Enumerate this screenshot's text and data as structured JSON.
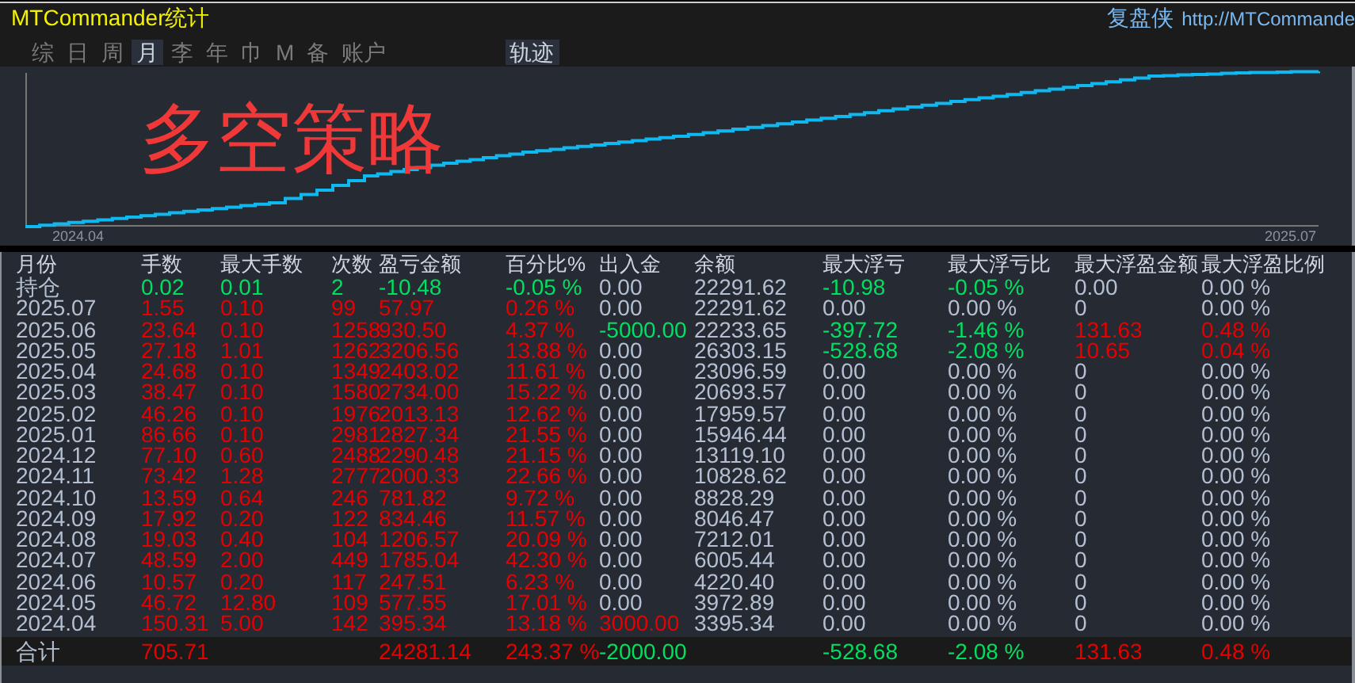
{
  "window": {
    "title": "MTCommander统计"
  },
  "header_right": {
    "brand": "复盘侠",
    "url": "http://MTCommande"
  },
  "tabs": [
    {
      "label": "综",
      "selected": false
    },
    {
      "label": "日",
      "selected": false
    },
    {
      "label": "周",
      "selected": false
    },
    {
      "label": "月",
      "selected": true
    },
    {
      "label": "李",
      "selected": false
    },
    {
      "label": "年",
      "selected": false
    },
    {
      "label": "巾",
      "selected": false
    },
    {
      "label": "M",
      "selected": false
    },
    {
      "label": "备",
      "selected": false
    },
    {
      "label": "账户",
      "selected": false
    }
  ],
  "view_toggle": {
    "label": "轨迹",
    "selected": true
  },
  "chart": {
    "title": "多空策略",
    "x_start_label": "2024.04",
    "x_end_label": "2025.07"
  },
  "table": {
    "columns": [
      "月份",
      "手数",
      "最大手数",
      "次数",
      "盈亏金额",
      "百分比%",
      "出入金",
      "余额",
      "最大浮亏",
      "最大浮亏比",
      "最大浮盈金额",
      "最大浮盈比例"
    ],
    "rows": [
      {
        "cells": [
          {
            "text": "持仓",
            "color": "#b4c0d2"
          },
          {
            "text": "0.02",
            "color": "#00e060"
          },
          {
            "text": "0.01",
            "color": "#00e060"
          },
          {
            "text": "2",
            "color": "#00e060"
          },
          {
            "text": "-10.48",
            "color": "#00e060"
          },
          {
            "text": "-0.05 %",
            "color": "#00e060"
          },
          {
            "text": "0.00",
            "color": "#b4c0d2"
          },
          {
            "text": "22291.62",
            "color": "#b4c0d2"
          },
          {
            "text": "-10.98",
            "color": "#00e060"
          },
          {
            "text": "-0.05 %",
            "color": "#00e060"
          },
          {
            "text": "0.00",
            "color": "#b4c0d2"
          },
          {
            "text": "0.00 %",
            "color": "#b4c0d2"
          }
        ]
      },
      {
        "cells": [
          {
            "text": "2025.07",
            "color": "#b4c0d2"
          },
          {
            "text": "1.55",
            "color": "#e80000"
          },
          {
            "text": "0.10",
            "color": "#e80000"
          },
          {
            "text": "99",
            "color": "#e80000"
          },
          {
            "text": "57.97",
            "color": "#e80000"
          },
          {
            "text": "0.26 %",
            "color": "#e80000"
          },
          {
            "text": "0.00",
            "color": "#b4c0d2"
          },
          {
            "text": "22291.62",
            "color": "#b4c0d2"
          },
          {
            "text": "0.00",
            "color": "#b4c0d2"
          },
          {
            "text": "0.00 %",
            "color": "#b4c0d2"
          },
          {
            "text": "0",
            "color": "#b4c0d2"
          },
          {
            "text": "0.00 %",
            "color": "#b4c0d2"
          }
        ]
      },
      {
        "cells": [
          {
            "text": "2025.06",
            "color": "#b4c0d2"
          },
          {
            "text": "23.64",
            "color": "#e80000"
          },
          {
            "text": "0.10",
            "color": "#e80000"
          },
          {
            "text": "1258",
            "color": "#e80000"
          },
          {
            "text": "930.50",
            "color": "#e80000"
          },
          {
            "text": "4.37 %",
            "color": "#e80000"
          },
          {
            "text": "-5000.00",
            "color": "#00e060"
          },
          {
            "text": "22233.65",
            "color": "#b4c0d2"
          },
          {
            "text": "-397.72",
            "color": "#00e060"
          },
          {
            "text": "-1.46 %",
            "color": "#00e060"
          },
          {
            "text": "131.63",
            "color": "#e80000"
          },
          {
            "text": "0.48 %",
            "color": "#e80000"
          }
        ]
      },
      {
        "cells": [
          {
            "text": "2025.05",
            "color": "#b4c0d2"
          },
          {
            "text": "27.18",
            "color": "#e80000"
          },
          {
            "text": "1.01",
            "color": "#e80000"
          },
          {
            "text": "1262",
            "color": "#e80000"
          },
          {
            "text": "3206.56",
            "color": "#e80000"
          },
          {
            "text": "13.88 %",
            "color": "#e80000"
          },
          {
            "text": "0.00",
            "color": "#b4c0d2"
          },
          {
            "text": "26303.15",
            "color": "#b4c0d2"
          },
          {
            "text": "-528.68",
            "color": "#00e060"
          },
          {
            "text": "-2.08 %",
            "color": "#00e060"
          },
          {
            "text": "10.65",
            "color": "#e80000"
          },
          {
            "text": "0.04 %",
            "color": "#e80000"
          }
        ]
      },
      {
        "cells": [
          {
            "text": "2025.04",
            "color": "#b4c0d2"
          },
          {
            "text": "24.68",
            "color": "#e80000"
          },
          {
            "text": "0.10",
            "color": "#e80000"
          },
          {
            "text": "1349",
            "color": "#e80000"
          },
          {
            "text": "2403.02",
            "color": "#e80000"
          },
          {
            "text": "11.61 %",
            "color": "#e80000"
          },
          {
            "text": "0.00",
            "color": "#b4c0d2"
          },
          {
            "text": "23096.59",
            "color": "#b4c0d2"
          },
          {
            "text": "0.00",
            "color": "#b4c0d2"
          },
          {
            "text": "0.00 %",
            "color": "#b4c0d2"
          },
          {
            "text": "0",
            "color": "#b4c0d2"
          },
          {
            "text": "0.00 %",
            "color": "#b4c0d2"
          }
        ]
      },
      {
        "cells": [
          {
            "text": "2025.03",
            "color": "#b4c0d2"
          },
          {
            "text": "38.47",
            "color": "#e80000"
          },
          {
            "text": "0.10",
            "color": "#e80000"
          },
          {
            "text": "1580",
            "color": "#e80000"
          },
          {
            "text": "2734.00",
            "color": "#e80000"
          },
          {
            "text": "15.22 %",
            "color": "#e80000"
          },
          {
            "text": "0.00",
            "color": "#b4c0d2"
          },
          {
            "text": "20693.57",
            "color": "#b4c0d2"
          },
          {
            "text": "0.00",
            "color": "#b4c0d2"
          },
          {
            "text": "0.00 %",
            "color": "#b4c0d2"
          },
          {
            "text": "0",
            "color": "#b4c0d2"
          },
          {
            "text": "0.00 %",
            "color": "#b4c0d2"
          }
        ]
      },
      {
        "cells": [
          {
            "text": "2025.02",
            "color": "#b4c0d2"
          },
          {
            "text": "46.26",
            "color": "#e80000"
          },
          {
            "text": "0.10",
            "color": "#e80000"
          },
          {
            "text": "1976",
            "color": "#e80000"
          },
          {
            "text": "2013.13",
            "color": "#e80000"
          },
          {
            "text": "12.62 %",
            "color": "#e80000"
          },
          {
            "text": "0.00",
            "color": "#b4c0d2"
          },
          {
            "text": "17959.57",
            "color": "#b4c0d2"
          },
          {
            "text": "0.00",
            "color": "#b4c0d2"
          },
          {
            "text": "0.00 %",
            "color": "#b4c0d2"
          },
          {
            "text": "0",
            "color": "#b4c0d2"
          },
          {
            "text": "0.00 %",
            "color": "#b4c0d2"
          }
        ]
      },
      {
        "cells": [
          {
            "text": "2025.01",
            "color": "#b4c0d2"
          },
          {
            "text": "86.66",
            "color": "#e80000"
          },
          {
            "text": "0.10",
            "color": "#e80000"
          },
          {
            "text": "2981",
            "color": "#e80000"
          },
          {
            "text": "2827.34",
            "color": "#e80000"
          },
          {
            "text": "21.55 %",
            "color": "#e80000"
          },
          {
            "text": "0.00",
            "color": "#b4c0d2"
          },
          {
            "text": "15946.44",
            "color": "#b4c0d2"
          },
          {
            "text": "0.00",
            "color": "#b4c0d2"
          },
          {
            "text": "0.00 %",
            "color": "#b4c0d2"
          },
          {
            "text": "0",
            "color": "#b4c0d2"
          },
          {
            "text": "0.00 %",
            "color": "#b4c0d2"
          }
        ]
      },
      {
        "cells": [
          {
            "text": "2024.12",
            "color": "#b4c0d2"
          },
          {
            "text": "77.10",
            "color": "#e80000"
          },
          {
            "text": "0.60",
            "color": "#e80000"
          },
          {
            "text": "2488",
            "color": "#e80000"
          },
          {
            "text": "2290.48",
            "color": "#e80000"
          },
          {
            "text": "21.15 %",
            "color": "#e80000"
          },
          {
            "text": "0.00",
            "color": "#b4c0d2"
          },
          {
            "text": "13119.10",
            "color": "#b4c0d2"
          },
          {
            "text": "0.00",
            "color": "#b4c0d2"
          },
          {
            "text": "0.00 %",
            "color": "#b4c0d2"
          },
          {
            "text": "0",
            "color": "#b4c0d2"
          },
          {
            "text": "0.00 %",
            "color": "#b4c0d2"
          }
        ]
      },
      {
        "cells": [
          {
            "text": "2024.11",
            "color": "#b4c0d2"
          },
          {
            "text": "73.42",
            "color": "#e80000"
          },
          {
            "text": "1.28",
            "color": "#e80000"
          },
          {
            "text": "2777",
            "color": "#e80000"
          },
          {
            "text": "2000.33",
            "color": "#e80000"
          },
          {
            "text": "22.66 %",
            "color": "#e80000"
          },
          {
            "text": "0.00",
            "color": "#b4c0d2"
          },
          {
            "text": "10828.62",
            "color": "#b4c0d2"
          },
          {
            "text": "0.00",
            "color": "#b4c0d2"
          },
          {
            "text": "0.00 %",
            "color": "#b4c0d2"
          },
          {
            "text": "0",
            "color": "#b4c0d2"
          },
          {
            "text": "0.00 %",
            "color": "#b4c0d2"
          }
        ]
      },
      {
        "cells": [
          {
            "text": "2024.10",
            "color": "#b4c0d2"
          },
          {
            "text": "13.59",
            "color": "#e80000"
          },
          {
            "text": "0.64",
            "color": "#e80000"
          },
          {
            "text": "246",
            "color": "#e80000"
          },
          {
            "text": "781.82",
            "color": "#e80000"
          },
          {
            "text": "9.72 %",
            "color": "#e80000"
          },
          {
            "text": "0.00",
            "color": "#b4c0d2"
          },
          {
            "text": "8828.29",
            "color": "#b4c0d2"
          },
          {
            "text": "0.00",
            "color": "#b4c0d2"
          },
          {
            "text": "0.00 %",
            "color": "#b4c0d2"
          },
          {
            "text": "0",
            "color": "#b4c0d2"
          },
          {
            "text": "0.00 %",
            "color": "#b4c0d2"
          }
        ]
      },
      {
        "cells": [
          {
            "text": "2024.09",
            "color": "#b4c0d2"
          },
          {
            "text": "17.92",
            "color": "#e80000"
          },
          {
            "text": "0.20",
            "color": "#e80000"
          },
          {
            "text": "122",
            "color": "#e80000"
          },
          {
            "text": "834.46",
            "color": "#e80000"
          },
          {
            "text": "11.57 %",
            "color": "#e80000"
          },
          {
            "text": "0.00",
            "color": "#b4c0d2"
          },
          {
            "text": "8046.47",
            "color": "#b4c0d2"
          },
          {
            "text": "0.00",
            "color": "#b4c0d2"
          },
          {
            "text": "0.00 %",
            "color": "#b4c0d2"
          },
          {
            "text": "0",
            "color": "#b4c0d2"
          },
          {
            "text": "0.00 %",
            "color": "#b4c0d2"
          }
        ]
      },
      {
        "cells": [
          {
            "text": "2024.08",
            "color": "#b4c0d2"
          },
          {
            "text": "19.03",
            "color": "#e80000"
          },
          {
            "text": "0.40",
            "color": "#e80000"
          },
          {
            "text": "104",
            "color": "#e80000"
          },
          {
            "text": "1206.57",
            "color": "#e80000"
          },
          {
            "text": "20.09 %",
            "color": "#e80000"
          },
          {
            "text": "0.00",
            "color": "#b4c0d2"
          },
          {
            "text": "7212.01",
            "color": "#b4c0d2"
          },
          {
            "text": "0.00",
            "color": "#b4c0d2"
          },
          {
            "text": "0.00 %",
            "color": "#b4c0d2"
          },
          {
            "text": "0",
            "color": "#b4c0d2"
          },
          {
            "text": "0.00 %",
            "color": "#b4c0d2"
          }
        ]
      },
      {
        "cells": [
          {
            "text": "2024.07",
            "color": "#b4c0d2"
          },
          {
            "text": "48.59",
            "color": "#e80000"
          },
          {
            "text": "2.00",
            "color": "#e80000"
          },
          {
            "text": "449",
            "color": "#e80000"
          },
          {
            "text": "1785.04",
            "color": "#e80000"
          },
          {
            "text": "42.30 %",
            "color": "#e80000"
          },
          {
            "text": "0.00",
            "color": "#b4c0d2"
          },
          {
            "text": "6005.44",
            "color": "#b4c0d2"
          },
          {
            "text": "0.00",
            "color": "#b4c0d2"
          },
          {
            "text": "0.00 %",
            "color": "#b4c0d2"
          },
          {
            "text": "0",
            "color": "#b4c0d2"
          },
          {
            "text": "0.00 %",
            "color": "#b4c0d2"
          }
        ]
      },
      {
        "cells": [
          {
            "text": "2024.06",
            "color": "#b4c0d2"
          },
          {
            "text": "10.57",
            "color": "#e80000"
          },
          {
            "text": "0.20",
            "color": "#e80000"
          },
          {
            "text": "117",
            "color": "#e80000"
          },
          {
            "text": "247.51",
            "color": "#e80000"
          },
          {
            "text": "6.23 %",
            "color": "#e80000"
          },
          {
            "text": "0.00",
            "color": "#b4c0d2"
          },
          {
            "text": "4220.40",
            "color": "#b4c0d2"
          },
          {
            "text": "0.00",
            "color": "#b4c0d2"
          },
          {
            "text": "0.00 %",
            "color": "#b4c0d2"
          },
          {
            "text": "0",
            "color": "#b4c0d2"
          },
          {
            "text": "0.00 %",
            "color": "#b4c0d2"
          }
        ]
      },
      {
        "cells": [
          {
            "text": "2024.05",
            "color": "#b4c0d2"
          },
          {
            "text": "46.72",
            "color": "#e80000"
          },
          {
            "text": "12.80",
            "color": "#e80000"
          },
          {
            "text": "109",
            "color": "#e80000"
          },
          {
            "text": "577.55",
            "color": "#e80000"
          },
          {
            "text": "17.01 %",
            "color": "#e80000"
          },
          {
            "text": "0.00",
            "color": "#b4c0d2"
          },
          {
            "text": "3972.89",
            "color": "#b4c0d2"
          },
          {
            "text": "0.00",
            "color": "#b4c0d2"
          },
          {
            "text": "0.00 %",
            "color": "#b4c0d2"
          },
          {
            "text": "0",
            "color": "#b4c0d2"
          },
          {
            "text": "0.00 %",
            "color": "#b4c0d2"
          }
        ]
      },
      {
        "cells": [
          {
            "text": "2024.04",
            "color": "#b4c0d2"
          },
          {
            "text": "150.31",
            "color": "#e80000"
          },
          {
            "text": "5.00",
            "color": "#e80000"
          },
          {
            "text": "142",
            "color": "#e80000"
          },
          {
            "text": "395.34",
            "color": "#e80000"
          },
          {
            "text": "13.18 %",
            "color": "#e80000"
          },
          {
            "text": "3000.00",
            "color": "#e80000"
          },
          {
            "text": "3395.34",
            "color": "#b4c0d2"
          },
          {
            "text": "0.00",
            "color": "#b4c0d2"
          },
          {
            "text": "0.00 %",
            "color": "#b4c0d2"
          },
          {
            "text": "0",
            "color": "#b4c0d2"
          },
          {
            "text": "0.00 %",
            "color": "#b4c0d2"
          }
        ]
      }
    ],
    "total": {
      "cells": [
        {
          "text": "合计",
          "color": "#b4c0d2"
        },
        {
          "text": "705.71",
          "color": "#e80000"
        },
        null,
        null,
        {
          "text": "24281.14",
          "color": "#e80000"
        },
        {
          "text": "243.37 %",
          "color": "#e80000"
        },
        {
          "text": "-2000.00",
          "color": "#00e060"
        },
        null,
        {
          "text": "-528.68",
          "color": "#00e060"
        },
        {
          "text": "-2.08 %",
          "color": "#00e060"
        },
        {
          "text": "131.63",
          "color": "#e80000"
        },
        {
          "text": "0.48 %",
          "color": "#e80000"
        }
      ]
    }
  }
}
